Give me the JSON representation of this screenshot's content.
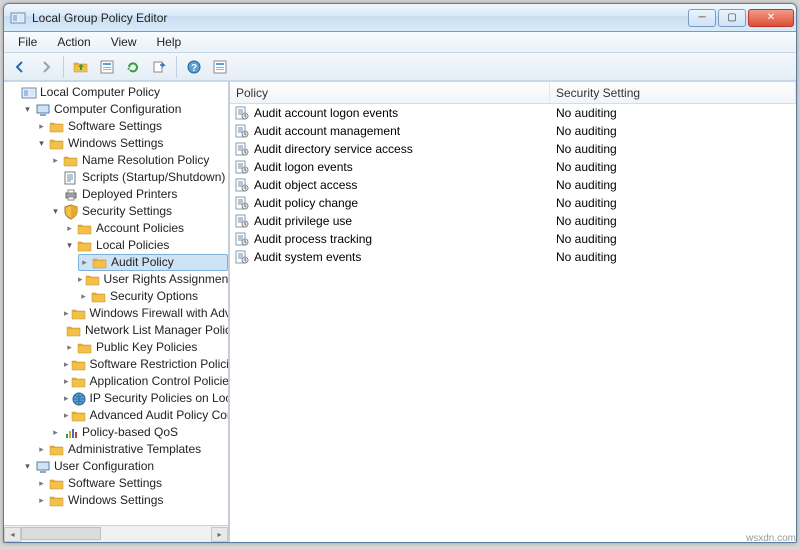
{
  "window": {
    "title": "Local Group Policy Editor"
  },
  "menus": [
    "File",
    "Action",
    "View",
    "Help"
  ],
  "tree": {
    "root": "Local Computer Policy",
    "computer_config": "Computer Configuration",
    "cc_software": "Software Settings",
    "cc_windows": "Windows Settings",
    "name_res": "Name Resolution Policy",
    "scripts": "Scripts (Startup/Shutdown)",
    "deployed_printers": "Deployed Printers",
    "security_settings": "Security Settings",
    "account_policies": "Account Policies",
    "local_policies": "Local Policies",
    "audit_policy": "Audit Policy",
    "user_rights": "User Rights Assignment",
    "security_options": "Security Options",
    "win_firewall": "Windows Firewall with Advanced Security",
    "net_list": "Network List Manager Policies",
    "public_key": "Public Key Policies",
    "soft_restrict": "Software Restriction Policies",
    "app_control": "Application Control Policies",
    "ip_sec": "IP Security Policies on Local Computer",
    "adv_audit": "Advanced Audit Policy Configuration",
    "policy_qos": "Policy-based QoS",
    "admin_templates": "Administrative Templates",
    "user_config": "User Configuration",
    "uc_software": "Software Settings",
    "uc_windows": "Windows Settings"
  },
  "list": {
    "columns": {
      "policy": "Policy",
      "security": "Security Setting"
    },
    "rows": [
      {
        "policy": "Audit account logon events",
        "setting": "No auditing"
      },
      {
        "policy": "Audit account management",
        "setting": "No auditing"
      },
      {
        "policy": "Audit directory service access",
        "setting": "No auditing"
      },
      {
        "policy": "Audit logon events",
        "setting": "No auditing"
      },
      {
        "policy": "Audit object access",
        "setting": "No auditing"
      },
      {
        "policy": "Audit policy change",
        "setting": "No auditing"
      },
      {
        "policy": "Audit privilege use",
        "setting": "No auditing"
      },
      {
        "policy": "Audit process tracking",
        "setting": "No auditing"
      },
      {
        "policy": "Audit system events",
        "setting": "No auditing"
      }
    ]
  },
  "watermark": "wsxdn.com"
}
